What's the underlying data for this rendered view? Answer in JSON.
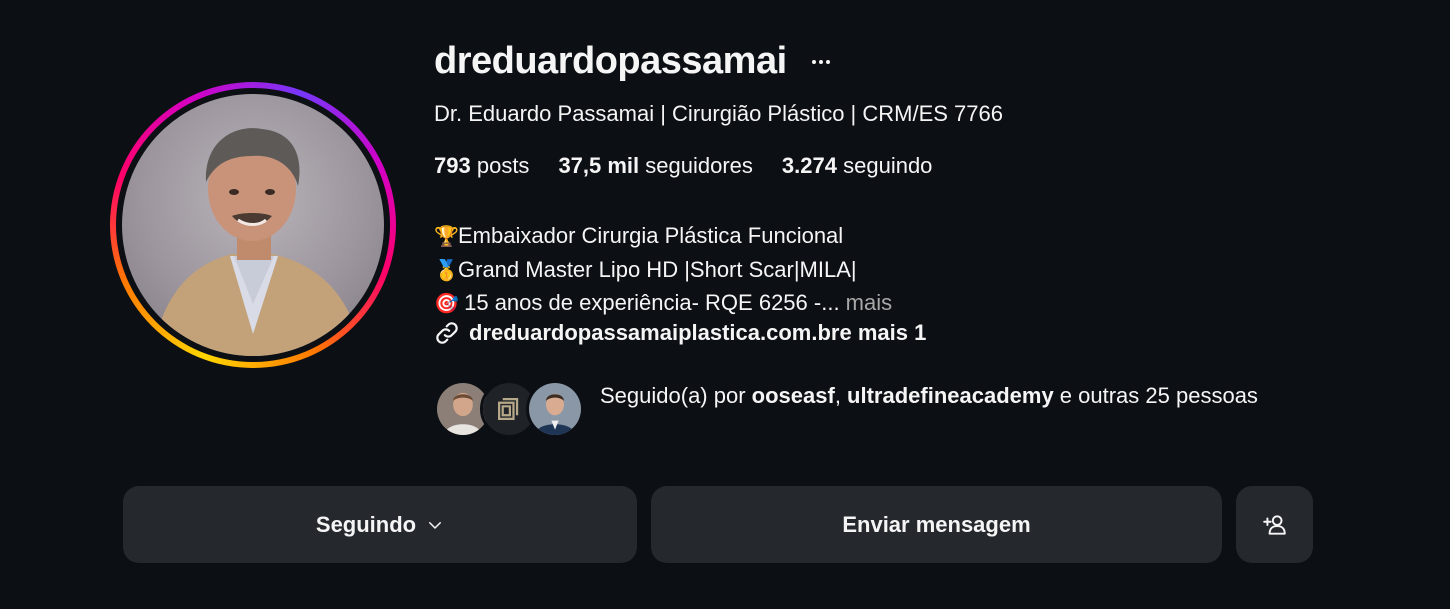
{
  "profile": {
    "username": "dreduardopassamai",
    "full_name": "Dr. Eduardo Passamai | Cirurgião Plástico | CRM/ES 7766"
  },
  "stats": {
    "posts_count": "793",
    "posts_label": "posts",
    "followers_count": "37,5 mil",
    "followers_label": "seguidores",
    "following_count": "3.274",
    "following_label": "seguindo"
  },
  "bio": {
    "line1_emoji": "🏆",
    "line1_text": "Embaixador Cirurgia Plástica Funcional",
    "line2_emoji": "🥇",
    "line2_text": "Grand Master Lipo HD |Short Scar|MILA|",
    "line3_emoji": "🎯",
    "line3_text": " 15 anos de experiência- RQE 6256 -...",
    "more_label": " mais"
  },
  "link": {
    "url_text": "dreduardopassamaiplastica.com.br",
    "extra_text": " e mais 1"
  },
  "followed_by": {
    "prefix": "Seguido(a) por ",
    "user1": "ooseasf",
    "separator": ", ",
    "user2": "ultradefineacademy",
    "suffix": " e outras 25 pessoas"
  },
  "actions": {
    "following_label": "Seguindo",
    "message_label": "Enviar mensagem"
  },
  "icons": {
    "more": "more-horizontal-icon",
    "link": "link-icon",
    "chevron": "chevron-down-icon",
    "add_user": "add-user-icon"
  },
  "colors": {
    "background": "#0c0f14",
    "button": "#25292e",
    "text": "#f5f5f5",
    "muted": "#a8a8a8"
  }
}
